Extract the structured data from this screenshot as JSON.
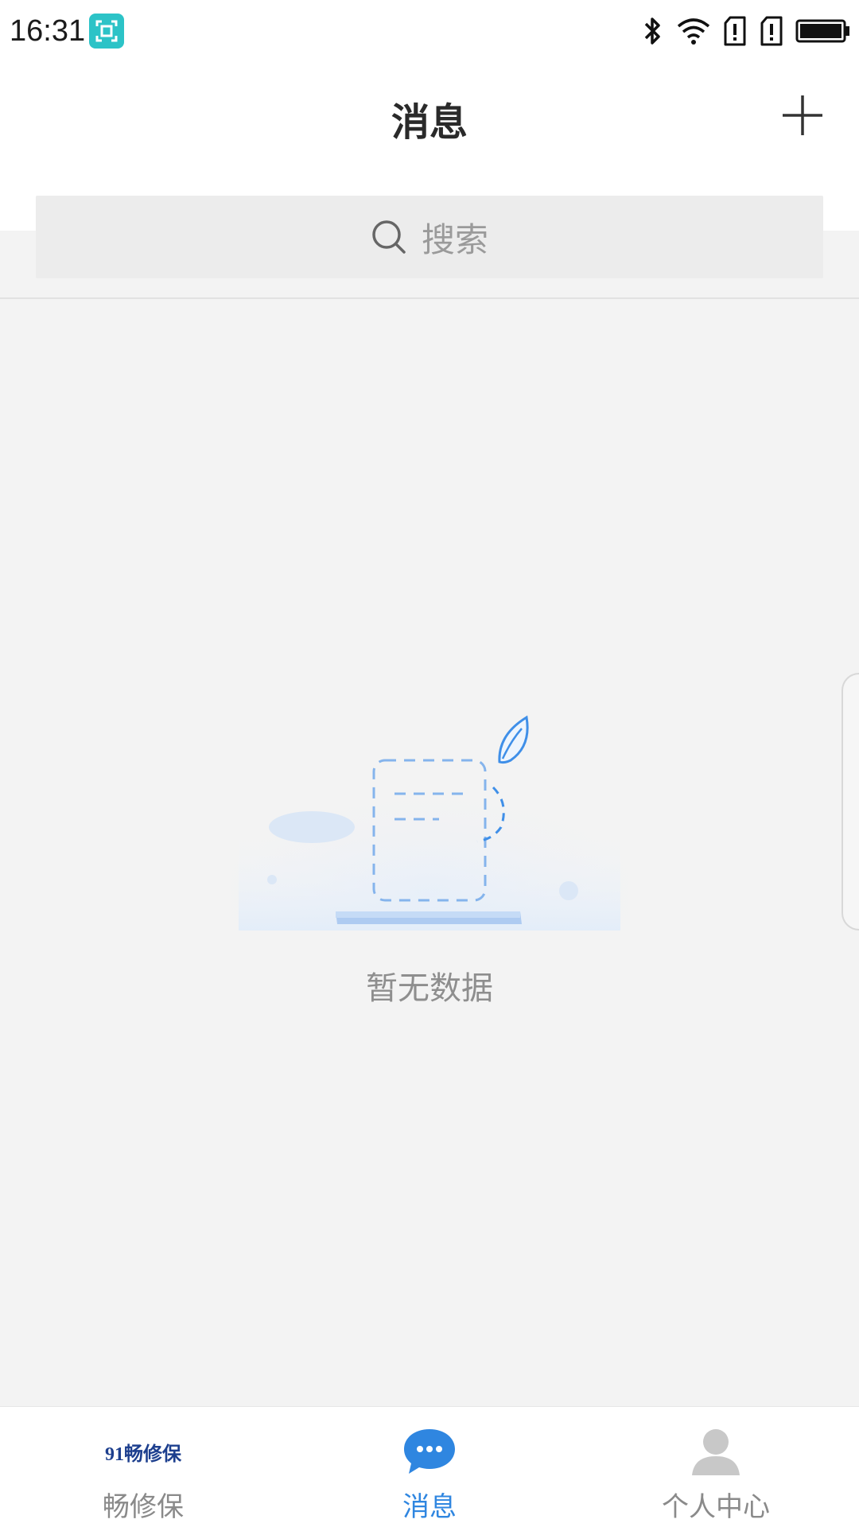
{
  "status_bar": {
    "time": "16:31",
    "icons": [
      "screenshot-app-icon",
      "bluetooth-icon",
      "wifi-icon",
      "sim-1-icon",
      "sim-2-icon",
      "battery-icon"
    ]
  },
  "header": {
    "title": "消息",
    "add_icon": "plus-icon"
  },
  "search": {
    "placeholder": "搜索",
    "icon": "search-icon"
  },
  "empty_state": {
    "message": "暂无数据",
    "illustration": "empty-document-cup-illustration"
  },
  "bottom_nav": {
    "items": [
      {
        "label": "畅修保",
        "icon": "app-logo",
        "logo_text": "91畅修保",
        "active": false
      },
      {
        "label": "消息",
        "icon": "chat-bubble-icon",
        "active": true
      },
      {
        "label": "个人中心",
        "icon": "person-icon",
        "active": false
      }
    ]
  },
  "colors": {
    "accent": "#2f86e0",
    "background": "#f3f3f3",
    "inactive_label": "#8a8a8a"
  }
}
